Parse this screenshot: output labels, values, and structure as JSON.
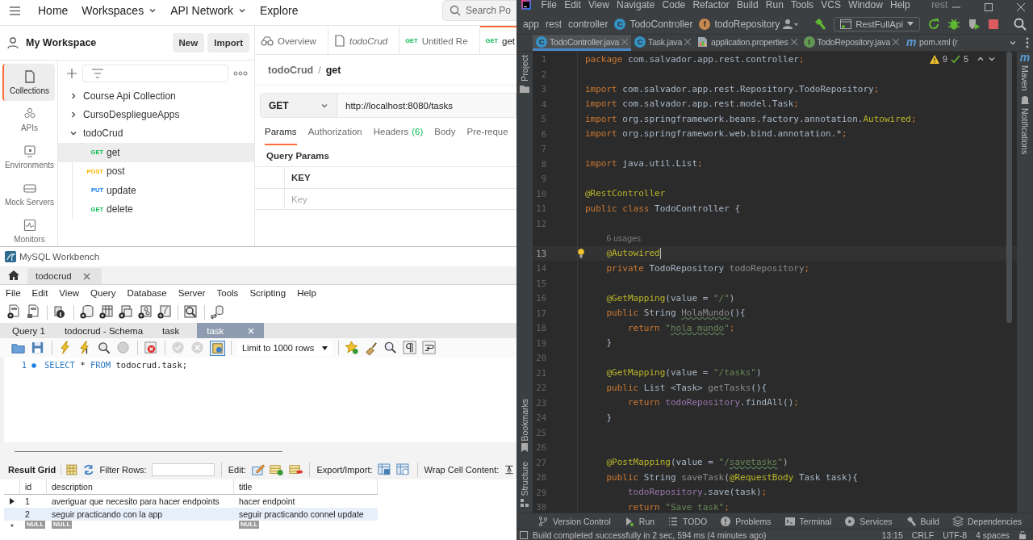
{
  "postman": {
    "nav": [
      {
        "label": "Home",
        "dropdown": false
      },
      {
        "label": "Workspaces",
        "dropdown": true
      },
      {
        "label": "API Network",
        "dropdown": true
      },
      {
        "label": "Explore",
        "dropdown": false
      }
    ],
    "search": {
      "placeholder": "Search Po"
    },
    "workspace": {
      "name": "My Workspace",
      "buttons": [
        "New",
        "Import"
      ]
    },
    "sidebar": [
      {
        "kind": "collections",
        "label": "Collections",
        "selected": true
      },
      {
        "kind": "apis",
        "label": "APIs",
        "selected": false
      },
      {
        "kind": "environments",
        "label": "Environments",
        "selected": false
      },
      {
        "kind": "mock",
        "label": "Mock Servers",
        "selected": false
      },
      {
        "kind": "monitors",
        "label": "Monitors",
        "selected": false
      }
    ],
    "tree": [
      {
        "label": "Course Api Collection",
        "expanded": false
      },
      {
        "label": "CursoDespliegueApps",
        "expanded": false
      },
      {
        "label": "todoCrud",
        "expanded": true,
        "children": [
          {
            "method": "GET",
            "color": "#0cbb52",
            "label": "get",
            "selected": true
          },
          {
            "method": "POST",
            "color": "#ffb400",
            "label": "post",
            "selected": false
          },
          {
            "method": "PUT",
            "color": "#097bed",
            "label": "update",
            "selected": false
          },
          {
            "method": "GET",
            "color": "#0cbb52",
            "label": "delete",
            "selected": false
          }
        ]
      }
    ],
    "tabs": [
      {
        "kind": "overview",
        "label": "Overview",
        "selected": false
      },
      {
        "kind": "collection",
        "label": "todoCrud",
        "selected": false
      },
      {
        "kind": "request",
        "method": "GET",
        "label": "Untitled Re",
        "selected": false
      },
      {
        "kind": "request",
        "method": "GET",
        "label": "get",
        "selected": true
      }
    ],
    "breadcrumb": {
      "parent": "todoCrud",
      "separator": "/",
      "current": "get"
    },
    "request": {
      "method": "GET",
      "url": "http://localhost:8080/tasks"
    },
    "request_tabs": [
      {
        "label": "Params",
        "selected": true
      },
      {
        "label": "Authorization",
        "selected": false
      },
      {
        "label": "Headers",
        "count": "(6)",
        "selected": false
      },
      {
        "label": "Body",
        "selected": false
      },
      {
        "label": "Pre-reque",
        "selected": false
      }
    ],
    "query_params": {
      "title": "Query Params",
      "column": "KEY",
      "placeholder": "Key"
    }
  },
  "workbench": {
    "title": "MySQL Workbench",
    "connection_tab": "todocrud",
    "menu": [
      "File",
      "Edit",
      "View",
      "Query",
      "Database",
      "Server",
      "Tools",
      "Scripting",
      "Help"
    ],
    "query_tabs": [
      {
        "label": "Query 1",
        "selected": false
      },
      {
        "label": "todocrud - Schema",
        "selected": false
      },
      {
        "label": "task",
        "selected": false
      },
      {
        "label": "task",
        "selected": true
      }
    ],
    "limit": "Limit to 1000 rows",
    "editor": {
      "number": "1",
      "tokens": [
        {
          "kind": "keyword",
          "text": "SELECT"
        },
        {
          "kind": "plain",
          "text": " * "
        },
        {
          "kind": "keyword",
          "text": "FROM"
        },
        {
          "kind": "plain",
          "text": " todocrud.task;"
        }
      ]
    },
    "results": {
      "labels": {
        "grid": "Result Grid",
        "filter": "Filter Rows:",
        "edit": "Edit:",
        "export": "Export/Import:",
        "wrap": "Wrap Cell Content:"
      },
      "columns": [
        "id",
        "description",
        "title"
      ],
      "rows": [
        {
          "cells": [
            "1",
            "averiguar que necesito para hacer endpoints",
            "hacer endpoint"
          ],
          "current": true,
          "selected": false
        },
        {
          "cells": [
            "2",
            "seguir practicando con la app",
            "seguir practicando connel update"
          ],
          "current": false,
          "selected": true
        }
      ],
      "new_row": {
        "marker": "*",
        "cells": [
          "NULL",
          "NULL",
          "NULL"
        ]
      }
    }
  },
  "intellij": {
    "menu": [
      "File",
      "Edit",
      "View",
      "Navigate",
      "Code",
      "Refactor",
      "Build",
      "Run",
      "Tools",
      "VCS",
      "Window",
      "Help"
    ],
    "title": "rest",
    "breadcrumb": [
      {
        "kind": "folder",
        "label": "app"
      },
      {
        "kind": "folder",
        "label": "rest"
      },
      {
        "kind": "folder",
        "label": "controller"
      },
      {
        "kind": "class",
        "letter": "C",
        "label": "TodoController"
      },
      {
        "kind": "field",
        "letter": "f",
        "label": "todoRepository"
      }
    ],
    "run_config": "RestFullApi",
    "tabs": [
      {
        "kind": "class",
        "letter": "C",
        "label": "TodoController.java",
        "selected": true
      },
      {
        "kind": "class",
        "letter": "C",
        "label": "Task.java",
        "selected": false
      },
      {
        "kind": "properties",
        "label": "application.properties",
        "selected": false
      },
      {
        "kind": "interface",
        "letter": "I",
        "label": "TodoRepository.java",
        "selected": false
      },
      {
        "kind": "maven",
        "letter": "m",
        "label": "pom.xml (r",
        "selected": false
      }
    ],
    "left_strip": {
      "top": "Project",
      "bottom": [
        "Bookmarks",
        "Structure"
      ]
    },
    "right_strip": {
      "maven_letter": "m",
      "maven": "Maven",
      "notifications": "Notifications"
    },
    "inspections": {
      "warnings": "9",
      "weak_warnings": "5"
    },
    "lines": [
      {
        "kind": "code",
        "number": "1",
        "current": false,
        "tokens": [
          {
            "kind": "kw",
            "text": "package"
          },
          {
            "kind": "plain",
            "text": " com.salvador.app.rest.controller"
          },
          {
            "kind": "kw",
            "text": ";"
          }
        ]
      },
      {
        "kind": "code",
        "number": "2",
        "current": false
      },
      {
        "kind": "code",
        "number": "3",
        "current": false,
        "tokens": [
          {
            "kind": "kw",
            "text": "import"
          },
          {
            "kind": "plain",
            "text": " com.salvador.app.rest.Repository.TodoRepository"
          },
          {
            "kind": "kw",
            "text": ";"
          }
        ]
      },
      {
        "kind": "code",
        "number": "4",
        "current": false,
        "tokens": [
          {
            "kind": "kw",
            "text": "import"
          },
          {
            "kind": "plain",
            "text": " com.salvador.app.rest.model.Task"
          },
          {
            "kind": "kw",
            "text": ";"
          }
        ]
      },
      {
        "kind": "code",
        "number": "5",
        "current": false,
        "tokens": [
          {
            "kind": "kw",
            "text": "import"
          },
          {
            "kind": "plain",
            "text": " org.springframework.beans.factory.annotation."
          },
          {
            "kind": "ann",
            "text": "Autowired"
          },
          {
            "kind": "kw",
            "text": ";"
          }
        ]
      },
      {
        "kind": "code",
        "number": "6",
        "current": false,
        "tokens": [
          {
            "kind": "kw",
            "text": "import"
          },
          {
            "kind": "plain",
            "text": " org.springframework.web.bind.annotation.*"
          },
          {
            "kind": "kw",
            "text": ";"
          }
        ]
      },
      {
        "kind": "code",
        "number": "7",
        "current": false
      },
      {
        "kind": "code",
        "number": "8",
        "current": false,
        "tokens": [
          {
            "kind": "kw",
            "text": "import"
          },
          {
            "kind": "plain",
            "text": " java.util.List"
          },
          {
            "kind": "kw",
            "text": ";"
          }
        ]
      },
      {
        "kind": "code",
        "number": "9",
        "current": false
      },
      {
        "kind": "code",
        "number": "10",
        "current": false,
        "tokens": [
          {
            "kind": "ann",
            "text": "@RestController"
          }
        ]
      },
      {
        "kind": "code",
        "number": "11",
        "current": false,
        "tokens": [
          {
            "kind": "kw",
            "text": "public class "
          },
          {
            "kind": "plain",
            "text": "TodoController {"
          }
        ]
      },
      {
        "kind": "code",
        "number": "12",
        "current": false
      },
      {
        "kind": "inlay",
        "text": "6 usages"
      },
      {
        "kind": "code",
        "number": "13",
        "current": true,
        "tokens": [
          {
            "kind": "ann",
            "text": "    @Autowired"
          }
        ]
      },
      {
        "kind": "code",
        "number": "14",
        "current": false,
        "tokens": [
          {
            "kind": "kw",
            "text": "    private "
          },
          {
            "kind": "plain",
            "text": "TodoRepository "
          },
          {
            "kind": "muted",
            "text": "todoRepository"
          },
          {
            "kind": "kw",
            "text": ";"
          }
        ]
      },
      {
        "kind": "code",
        "number": "15",
        "current": false
      },
      {
        "kind": "code",
        "number": "16",
        "current": false,
        "tokens": [
          {
            "kind": "ann",
            "text": "    @GetMapping"
          },
          {
            "kind": "plain",
            "text": "(value = "
          },
          {
            "kind": "str",
            "text": "\"/\""
          },
          {
            "kind": "plain",
            "text": ")"
          }
        ]
      },
      {
        "kind": "code",
        "number": "17",
        "current": false,
        "tokens": [
          {
            "kind": "kw",
            "text": "    public "
          },
          {
            "kind": "plain",
            "text": "String "
          },
          {
            "kind": "muted_typo",
            "text": "HolaMundo"
          },
          {
            "kind": "plain",
            "text": "(){"
          }
        ]
      },
      {
        "kind": "code",
        "number": "18",
        "current": false,
        "tokens": [
          {
            "kind": "kw",
            "text": "        return "
          },
          {
            "kind": "str",
            "text": "\""
          },
          {
            "kind": "str_typo",
            "text": "hola mundo"
          },
          {
            "kind": "str",
            "text": "\""
          },
          {
            "kind": "kw",
            "text": ";"
          }
        ]
      },
      {
        "kind": "code",
        "number": "19",
        "current": false,
        "tokens": [
          {
            "kind": "plain",
            "text": "    }"
          }
        ]
      },
      {
        "kind": "code",
        "number": "20",
        "current": false
      },
      {
        "kind": "code",
        "number": "21",
        "current": false,
        "tokens": [
          {
            "kind": "ann",
            "text": "    @GetMapping"
          },
          {
            "kind": "plain",
            "text": "(value = "
          },
          {
            "kind": "str",
            "text": "\"/tasks\""
          },
          {
            "kind": "plain",
            "text": ")"
          }
        ]
      },
      {
        "kind": "code",
        "number": "22",
        "current": false,
        "tokens": [
          {
            "kind": "kw",
            "text": "    public "
          },
          {
            "kind": "plain",
            "text": "List <Task> "
          },
          {
            "kind": "muted",
            "text": "getTasks"
          },
          {
            "kind": "plain",
            "text": "(){"
          }
        ]
      },
      {
        "kind": "code",
        "number": "23",
        "current": false,
        "tokens": [
          {
            "kind": "kw",
            "text": "        return "
          },
          {
            "kind": "field",
            "text": "todoRepository"
          },
          {
            "kind": "plain",
            "text": ".findAll()"
          },
          {
            "kind": "kw",
            "text": ";"
          }
        ]
      },
      {
        "kind": "code",
        "number": "24",
        "current": false,
        "tokens": [
          {
            "kind": "plain",
            "text": "    }"
          }
        ]
      },
      {
        "kind": "code",
        "number": "25",
        "current": false
      },
      {
        "kind": "code",
        "number": "26",
        "current": false
      },
      {
        "kind": "code",
        "number": "27",
        "current": false,
        "tokens": [
          {
            "kind": "ann",
            "text": "    @PostMapping"
          },
          {
            "kind": "plain",
            "text": "(value = "
          },
          {
            "kind": "str",
            "text": "\"/"
          },
          {
            "kind": "str_typo",
            "text": "savetasks"
          },
          {
            "kind": "str",
            "text": "\""
          },
          {
            "kind": "plain",
            "text": ")"
          }
        ]
      },
      {
        "kind": "code",
        "number": "28",
        "current": false,
        "tokens": [
          {
            "kind": "kw",
            "text": "    public "
          },
          {
            "kind": "plain",
            "text": "String "
          },
          {
            "kind": "muted",
            "text": "saveTask"
          },
          {
            "kind": "plain",
            "text": "("
          },
          {
            "kind": "ann",
            "text": "@RequestBody"
          },
          {
            "kind": "plain",
            "text": " Task task){"
          }
        ]
      },
      {
        "kind": "code",
        "number": "29",
        "current": false,
        "tokens": [
          {
            "kind": "field",
            "text": "        todoRepository"
          },
          {
            "kind": "plain",
            "text": ".save(task)"
          },
          {
            "kind": "kw",
            "text": ";"
          }
        ]
      },
      {
        "kind": "code",
        "number": "30",
        "current": false,
        "tokens": [
          {
            "kind": "kw",
            "text": "        return "
          },
          {
            "kind": "str",
            "text": "\"Save task\""
          },
          {
            "kind": "kw",
            "text": ";"
          }
        ]
      }
    ],
    "tool_tabs": [
      {
        "kind": "vcs",
        "label": "Version Control"
      },
      {
        "kind": "run",
        "label": "Run"
      },
      {
        "kind": "todo",
        "label": "TODO"
      },
      {
        "kind": "problems",
        "label": "Problems"
      },
      {
        "kind": "terminal",
        "label": "Terminal"
      },
      {
        "kind": "services",
        "label": "Services"
      },
      {
        "kind": "build",
        "label": "Build"
      },
      {
        "kind": "dependencies",
        "label": "Dependencies"
      }
    ],
    "status": {
      "message": "Build completed successfully in 2 sec, 594 ms (4 minutes ago)",
      "items": [
        "13:15",
        "CRLF",
        "UTF-8",
        "4 spaces"
      ]
    }
  }
}
